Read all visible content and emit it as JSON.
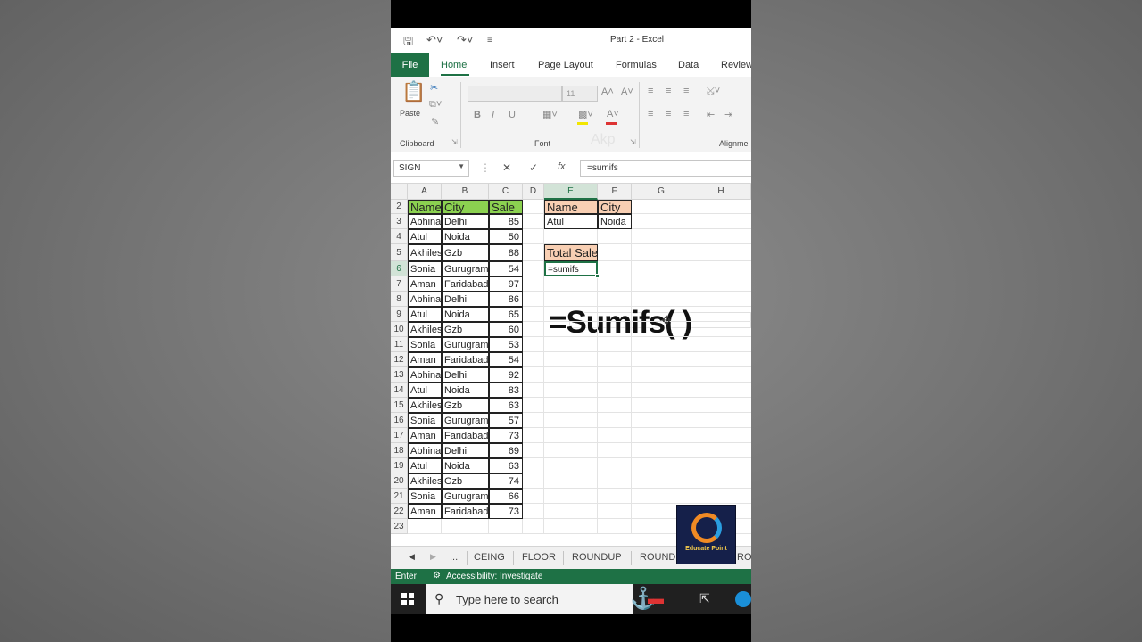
{
  "window": {
    "title": "Part 2  -  Excel"
  },
  "ribbon": {
    "tabs": [
      "File",
      "Home",
      "Insert",
      "Page Layout",
      "Formulas",
      "Data",
      "Review"
    ],
    "groups": {
      "clipboard": "Clipboard",
      "font": "Font",
      "alignment": "Alignme"
    },
    "paste_label": "Paste",
    "font_size": "11",
    "font_buttons": {
      "bold": "B",
      "italic": "I",
      "underline": "U"
    },
    "watermark": "Akp"
  },
  "formula_bar": {
    "name_box": "SIGN",
    "fx": "fx",
    "formula": "=sumifs"
  },
  "columns": [
    "A",
    "B",
    "C",
    "D",
    "E",
    "F",
    "G",
    "H"
  ],
  "rows": [
    "2",
    "3",
    "4",
    "5",
    "6",
    "7",
    "8",
    "9",
    "10",
    "11",
    "12",
    "13",
    "14",
    "15",
    "16",
    "17",
    "18",
    "19",
    "20",
    "21",
    "22",
    "23"
  ],
  "table": {
    "headers": [
      "Name",
      "City",
      "Sale"
    ],
    "data": [
      [
        "Abhinav",
        "Delhi",
        "85"
      ],
      [
        "Atul",
        "Noida",
        "50"
      ],
      [
        "Akhilesh",
        "Gzb",
        "88"
      ],
      [
        "Sonia",
        "Gurugram",
        "54"
      ],
      [
        "Aman",
        "Faridabad",
        "97"
      ],
      [
        "Abhinav",
        "Delhi",
        "86"
      ],
      [
        "Atul",
        "Noida",
        "65"
      ],
      [
        "Akhilesh",
        "Gzb",
        "60"
      ],
      [
        "Sonia",
        "Gurugram",
        "53"
      ],
      [
        "Aman",
        "Faridabad",
        "54"
      ],
      [
        "Abhinav",
        "Delhi",
        "92"
      ],
      [
        "Atul",
        "Noida",
        "83"
      ],
      [
        "Akhilesh",
        "Gzb",
        "63"
      ],
      [
        "Sonia",
        "Gurugram",
        "57"
      ],
      [
        "Aman",
        "Faridabad",
        "73"
      ],
      [
        "Abhinav",
        "Delhi",
        "69"
      ],
      [
        "Atul",
        "Noida",
        "63"
      ],
      [
        "Akhilesh",
        "Gzb",
        "74"
      ],
      [
        "Sonia",
        "Gurugram",
        "66"
      ],
      [
        "Aman",
        "Faridabad",
        "73"
      ]
    ]
  },
  "criteria": {
    "name_header": "Name",
    "city_header": "City",
    "name_value": "Atul",
    "city_value": "Noida"
  },
  "total": {
    "label": "Total Sale",
    "editing": "=sumifs"
  },
  "overlay_text": "=Sumifs( )",
  "sheet_tabs": {
    "more": "...",
    "tabs": [
      "CEING",
      "FLOOR",
      "ROUNDUP",
      "ROUND",
      "ROU"
    ]
  },
  "status": {
    "mode": "Enter",
    "accessibility": "Accessibility: Investigate"
  },
  "taskbar": {
    "search_placeholder": "Type here to search"
  },
  "logo": {
    "text": "Educate Point"
  },
  "colors": {
    "excel_green": "#1e7145",
    "header_green": "#8bd150",
    "header_peach": "#f8cfb3"
  }
}
